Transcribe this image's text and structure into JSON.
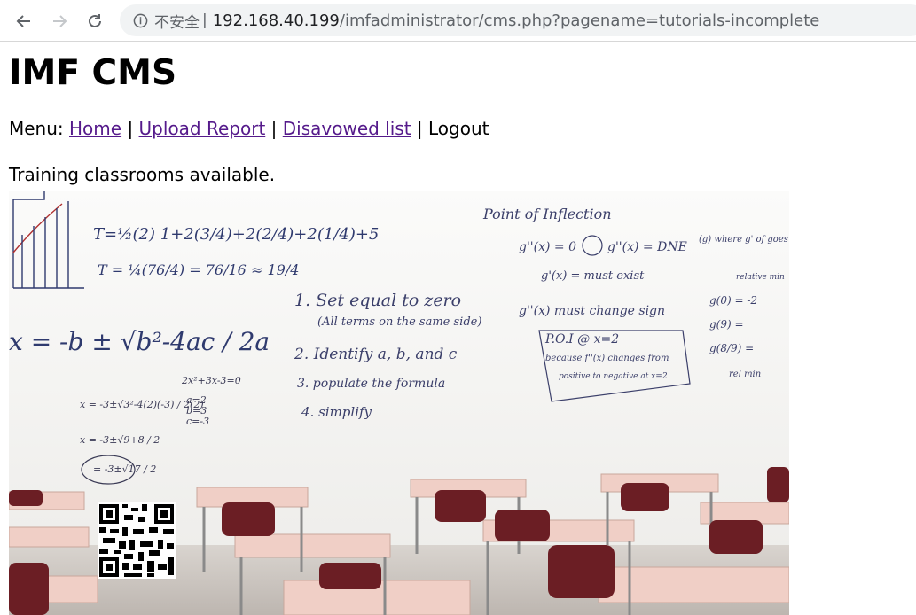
{
  "browser": {
    "insecure_label": "不安全",
    "separator": "|",
    "url_host": "192.168.40.199",
    "url_path": "/imfadministrator/cms.php?pagename=tutorials-incomplete"
  },
  "page": {
    "title": "IMF CMS",
    "menu_prefix": "Menu:",
    "menu": [
      {
        "label": "Home",
        "link": true
      },
      {
        "label": "Upload Report",
        "link": true
      },
      {
        "label": "Disavowed list",
        "link": true
      },
      {
        "label": "Logout",
        "link": false
      }
    ],
    "menu_separator": "|",
    "intro_text": "Training classrooms available."
  },
  "image": {
    "description_icon": "classroom-whiteboard-photo",
    "whiteboard_text": {
      "left_formula": "x = -b ± √b²-4ac / 2a",
      "t_formula_1": "T=½(2) 1+2(3/4)+2(2/4)+2(1/4)+5",
      "t_formula_2": "T = ¼(76/4) = 76/16 ≈ 19/4",
      "steps": [
        "1. Set equal to zero",
        "(All terms on the same side)",
        "2. Identify a, b, and c",
        "3. populate the formula",
        "4. simplify"
      ],
      "point_title": "Point of Inflection",
      "g1": "g''(x) = 0",
      "g2": "g''(x) = DNE",
      "g3": "g'(x) = must exist",
      "g4": "g''(x) must change sign",
      "poi": "P.O.I @ x=2",
      "because": "because f''(x) changes from",
      "because2": "positive to negative at x=2",
      "right_note": "(g) where g' of goes from - to +",
      "right_note2": "relative min",
      "g0": "g(0) = -2",
      "g9": "g(9) =",
      "g89": "g(8/9) =",
      "rel_min": "rel min"
    }
  },
  "colors": {
    "link": "#551a8b",
    "text": "#000000",
    "omnibox": "#f1f3f4",
    "chair": "#6b1e24",
    "desk": "#f0cfc6",
    "ink_blue": "#3b4a8a"
  }
}
